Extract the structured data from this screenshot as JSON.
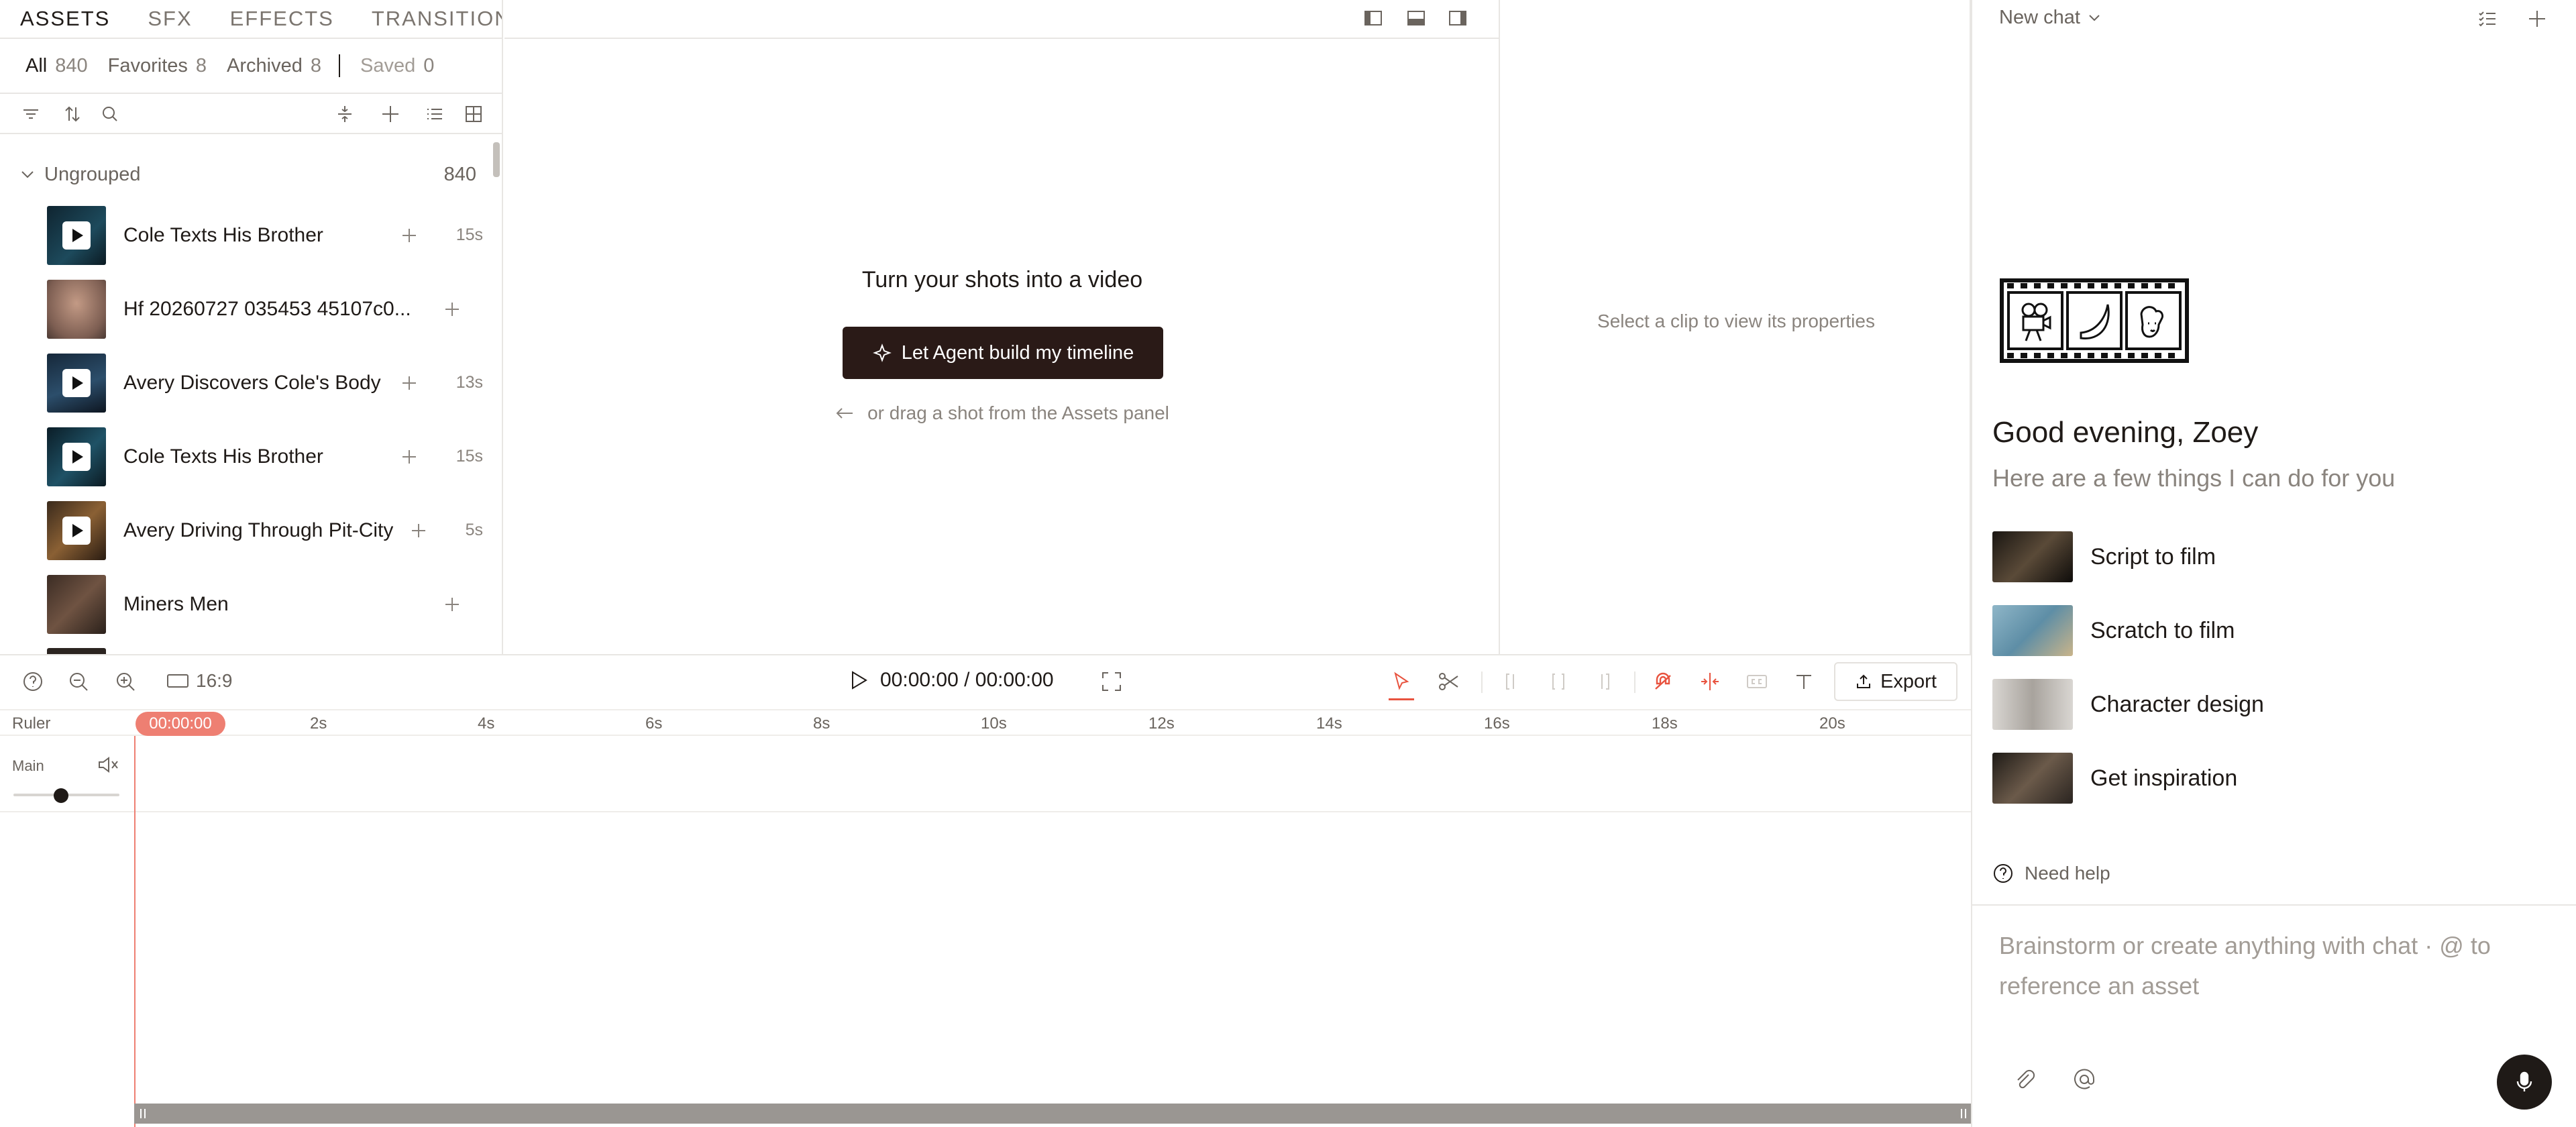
{
  "assets": {
    "tabs": [
      "ASSETS",
      "SFX",
      "EFFECTS",
      "TRANSITIONS"
    ],
    "filters": {
      "all": {
        "label": "All",
        "count": "840"
      },
      "favorites": {
        "label": "Favorites",
        "count": "8"
      },
      "archived": {
        "label": "Archived",
        "count": "8"
      },
      "saved": {
        "label": "Saved",
        "count": "0"
      }
    },
    "group": {
      "name": "Ungrouped",
      "count": "840"
    },
    "items": [
      {
        "title": "Cole Texts His Brother",
        "duration": "15s"
      },
      {
        "title": "Hf 20260727 035453 45107c0...",
        "duration": ""
      },
      {
        "title": "Avery Discovers Cole's Body",
        "duration": "13s"
      },
      {
        "title": "Cole Texts His Brother",
        "duration": "15s"
      },
      {
        "title": "Avery Driving Through Pit-City",
        "duration": "5s"
      },
      {
        "title": "Miners Men",
        "duration": ""
      }
    ]
  },
  "preview": {
    "heading": "Turn your shots into a video",
    "agent_button": "Let Agent build my timeline",
    "drag_hint": "or drag a shot from the Assets panel"
  },
  "properties": {
    "hint": "Select a clip to view its properties"
  },
  "timeline": {
    "aspect": "16:9",
    "timecode": "00:00:00 / 00:00:00",
    "export_label": "Export",
    "ruler_label": "Ruler",
    "playhead": "00:00:00",
    "ticks": [
      "2s",
      "4s",
      "6s",
      "8s",
      "10s",
      "12s",
      "14s",
      "16s",
      "18s",
      "20s"
    ],
    "track_name": "Main",
    "volume": 0.45
  },
  "chat": {
    "title": "New chat",
    "greeting": "Good evening, Zoey",
    "subtitle": "Here are a few things I can do for you",
    "suggestions": [
      {
        "label": "Script to film"
      },
      {
        "label": "Scratch to film"
      },
      {
        "label": "Character design"
      },
      {
        "label": "Get inspiration"
      }
    ],
    "need_help": "Need help",
    "placeholder": "Brainstorm or create anything with chat · @ to reference an asset"
  },
  "colors": {
    "accent": "#ee7f72",
    "dark_button": "#2a1a17",
    "export_red": "#e8533f"
  }
}
